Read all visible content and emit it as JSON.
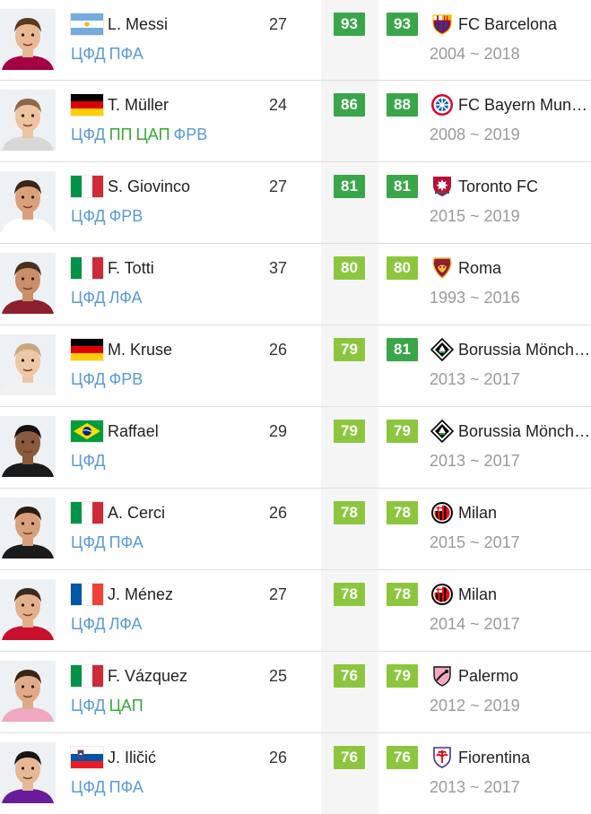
{
  "colors": {
    "rating_dark_green": "#3aa64a",
    "rating_light_green": "#8cc63f",
    "position_blue": "#5b9bd5",
    "position_green": "#38a838",
    "contract_gray": "#9a9a9a"
  },
  "players": [
    {
      "name": "L. Messi",
      "flag_icon": "argentina-flag-icon",
      "age": "27",
      "overall": "93",
      "potential": "93",
      "overall_color": "#3aa64a",
      "potential_color": "#3aa64a",
      "positions": [
        {
          "label": "ЦФД",
          "color": "blue"
        },
        {
          "label": "ПФА",
          "color": "blue"
        }
      ],
      "club": "FC Barcelona",
      "club_icon": "fc-barcelona-crest-icon",
      "contract": "2004 ~ 2018"
    },
    {
      "name": "T. Müller",
      "flag_icon": "germany-flag-icon",
      "age": "24",
      "overall": "86",
      "potential": "88",
      "overall_color": "#3aa64a",
      "potential_color": "#3aa64a",
      "positions": [
        {
          "label": "ЦФД",
          "color": "blue"
        },
        {
          "label": "ПП",
          "color": "green"
        },
        {
          "label": "ЦАП",
          "color": "green"
        },
        {
          "label": "ФРВ",
          "color": "blue"
        }
      ],
      "club": "FC Bayern Munich",
      "club_icon": "bayern-munich-crest-icon",
      "contract": "2008 ~ 2019"
    },
    {
      "name": "S. Giovinco",
      "flag_icon": "italy-flag-icon",
      "age": "27",
      "overall": "81",
      "potential": "81",
      "overall_color": "#3aa64a",
      "potential_color": "#3aa64a",
      "positions": [
        {
          "label": "ЦФД",
          "color": "blue"
        },
        {
          "label": "ФРВ",
          "color": "blue"
        }
      ],
      "club": "Toronto FC",
      "club_icon": "toronto-fc-crest-icon",
      "contract": "2015 ~ 2019"
    },
    {
      "name": "F. Totti",
      "flag_icon": "italy-flag-icon",
      "age": "37",
      "overall": "80",
      "potential": "80",
      "overall_color": "#8cc63f",
      "potential_color": "#8cc63f",
      "positions": [
        {
          "label": "ЦФД",
          "color": "blue"
        },
        {
          "label": "ЛФА",
          "color": "blue"
        }
      ],
      "club": "Roma",
      "club_icon": "roma-crest-icon",
      "contract": "1993 ~ 2016"
    },
    {
      "name": "M. Kruse",
      "flag_icon": "germany-flag-icon",
      "age": "26",
      "overall": "79",
      "potential": "81",
      "overall_color": "#8cc63f",
      "potential_color": "#3aa64a",
      "positions": [
        {
          "label": "ЦФД",
          "color": "blue"
        },
        {
          "label": "ФРВ",
          "color": "blue"
        }
      ],
      "club": "Borussia Mönchengladbach",
      "club_icon": "gladbach-crest-icon",
      "contract": "2013 ~ 2017"
    },
    {
      "name": "Raffael",
      "flag_icon": "brazil-flag-icon",
      "age": "29",
      "overall": "79",
      "potential": "79",
      "overall_color": "#8cc63f",
      "potential_color": "#8cc63f",
      "positions": [
        {
          "label": "ЦФД",
          "color": "blue"
        }
      ],
      "club": "Borussia Mönchengladbach",
      "club_icon": "gladbach-crest-icon",
      "contract": "2013 ~ 2017"
    },
    {
      "name": "A. Cerci",
      "flag_icon": "italy-flag-icon",
      "age": "26",
      "overall": "78",
      "potential": "78",
      "overall_color": "#8cc63f",
      "potential_color": "#8cc63f",
      "positions": [
        {
          "label": "ЦФД",
          "color": "blue"
        },
        {
          "label": "ПФА",
          "color": "blue"
        }
      ],
      "club": "Milan",
      "club_icon": "ac-milan-crest-icon",
      "contract": "2015 ~ 2017"
    },
    {
      "name": "J. Ménez",
      "flag_icon": "france-flag-icon",
      "age": "27",
      "overall": "78",
      "potential": "78",
      "overall_color": "#8cc63f",
      "potential_color": "#8cc63f",
      "positions": [
        {
          "label": "ЦФД",
          "color": "blue"
        },
        {
          "label": "ЛФА",
          "color": "blue"
        }
      ],
      "club": "Milan",
      "club_icon": "ac-milan-crest-icon",
      "contract": "2014 ~ 2017"
    },
    {
      "name": "F. Vázquez",
      "flag_icon": "italy-flag-icon",
      "age": "25",
      "overall": "76",
      "potential": "79",
      "overall_color": "#8cc63f",
      "potential_color": "#8cc63f",
      "positions": [
        {
          "label": "ЦФД",
          "color": "blue"
        },
        {
          "label": "ЦАП",
          "color": "green"
        }
      ],
      "club": "Palermo",
      "club_icon": "palermo-crest-icon",
      "contract": "2012 ~ 2019"
    },
    {
      "name": "J. Iličić",
      "flag_icon": "slovenia-flag-icon",
      "age": "26",
      "overall": "76",
      "potential": "76",
      "overall_color": "#8cc63f",
      "potential_color": "#8cc63f",
      "positions": [
        {
          "label": "ЦФД",
          "color": "blue"
        },
        {
          "label": "ПФА",
          "color": "blue"
        }
      ],
      "club": "Fiorentina",
      "club_icon": "fiorentina-crest-icon",
      "contract": "2013 ~ 2017"
    }
  ]
}
